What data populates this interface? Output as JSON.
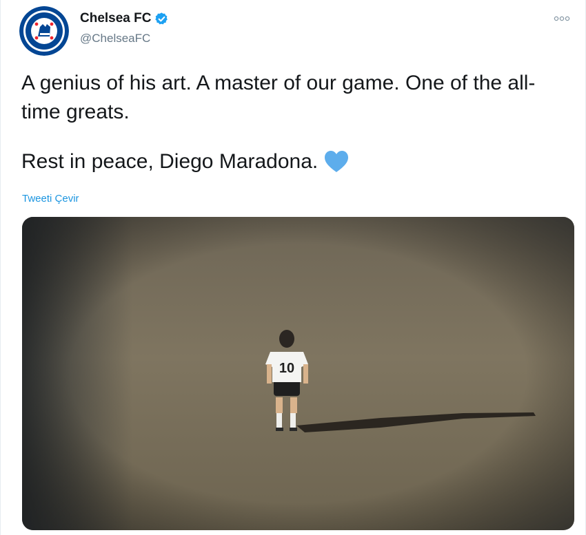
{
  "account": {
    "display_name": "Chelsea FC",
    "handle": "@ChelseaFC",
    "verified": true
  },
  "icons": {
    "verified": "verified-badge-icon",
    "more": "more-options-icon",
    "heart": "blue-heart-icon",
    "avatar": "chelsea-crest"
  },
  "tweet": {
    "line1": "A genius of his art. A master of our game. One of the all-time greats.",
    "line2": "Rest in peace, Diego Maradona.",
    "translate_label": "Tweeti Çevir"
  },
  "media": {
    "player_number": "10"
  },
  "colors": {
    "brand_blue": "#034694",
    "verified_blue": "#1da1f2",
    "heart_blue": "#5dadec",
    "link_blue": "#1b95e0",
    "pitch": "#7a6f5c"
  }
}
